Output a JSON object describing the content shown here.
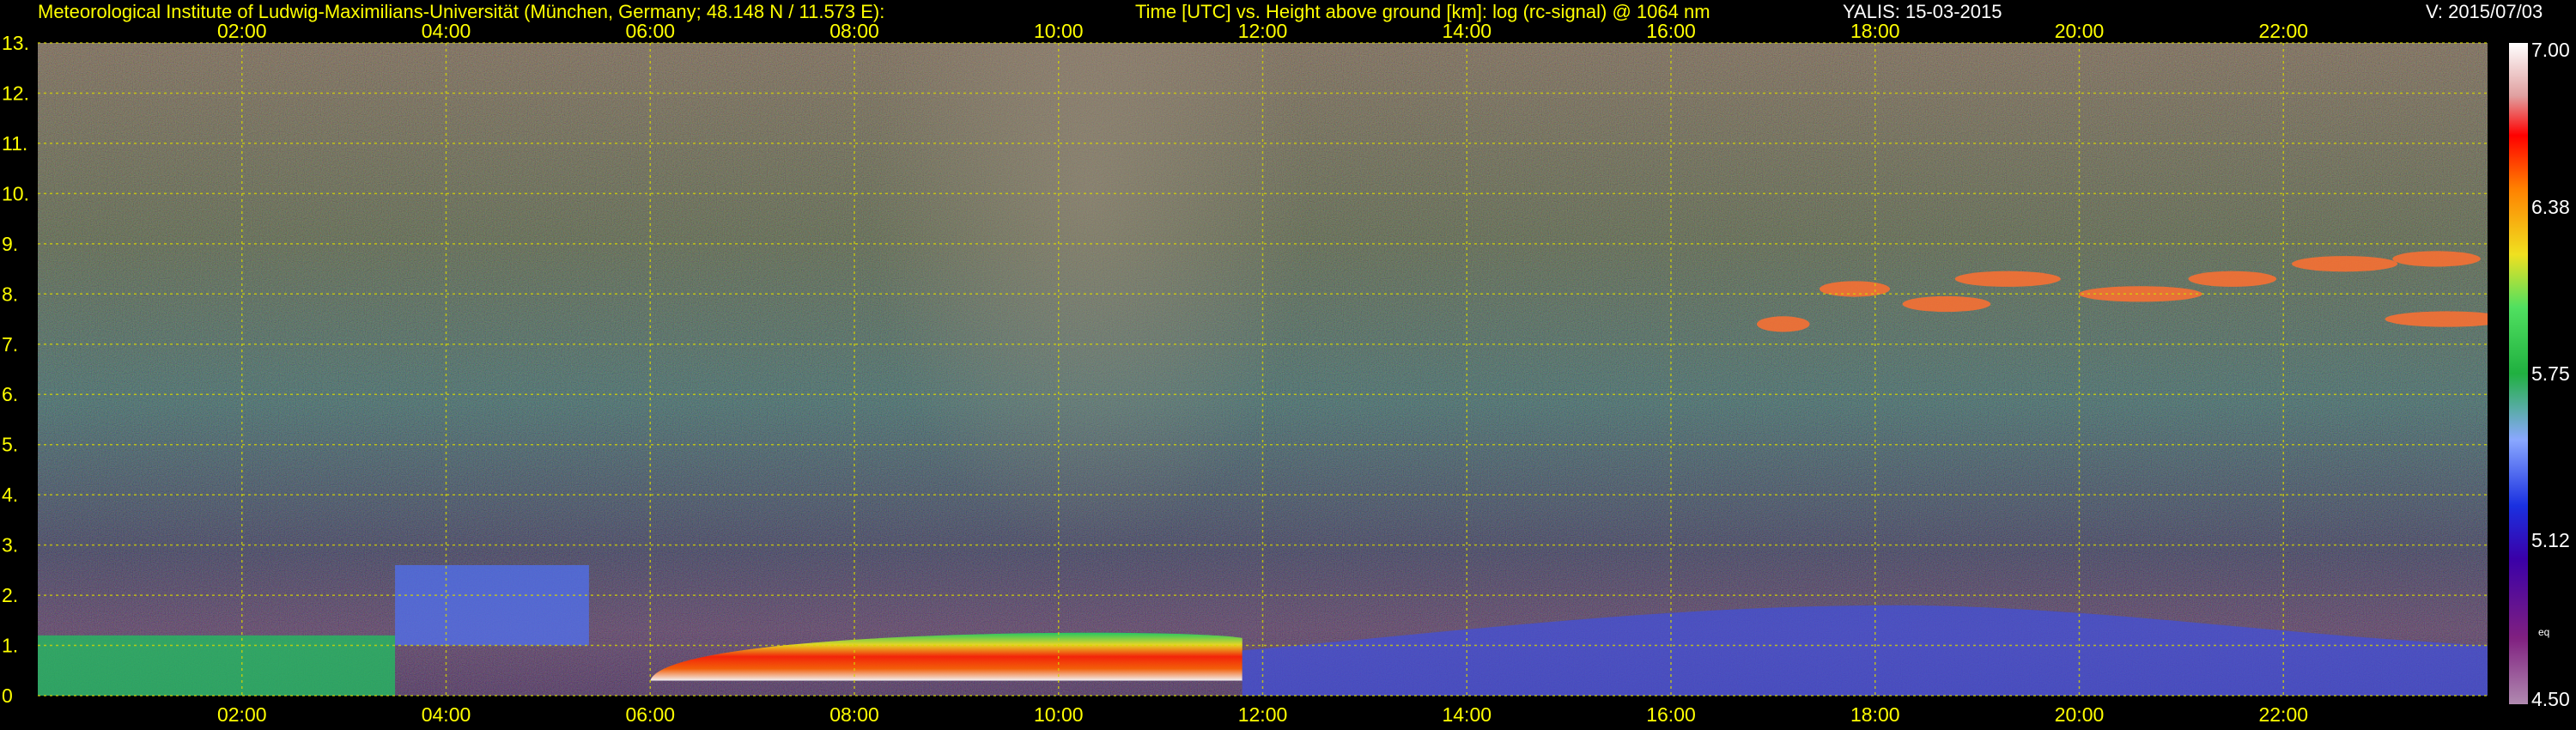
{
  "header": {
    "institute": "Meteorological Institute of Ludwig-Maximilians-Universität (München, Germany; 48.148 N / 11.573 E):",
    "description": "Time [UTC] vs. Height above ground [km]: log (rc-signal) @ 1064 nm",
    "system": "YALIS: 15-03-2015",
    "version": "V: 2015/07/03"
  },
  "chart_data": {
    "type": "heatmap",
    "title": "Time [UTC] vs. Height above ground [km]: log (rc-signal) @ 1064 nm",
    "x_ticks": [
      "02:00",
      "04:00",
      "06:00",
      "08:00",
      "10:00",
      "12:00",
      "14:00",
      "16:00",
      "18:00",
      "20:00",
      "22:00"
    ],
    "x_tick_hours": [
      2,
      4,
      6,
      8,
      10,
      12,
      14,
      16,
      18,
      20,
      22
    ],
    "xlim_hours": [
      0,
      24
    ],
    "y_ticks": [
      "0",
      "1.",
      "2.",
      "3.",
      "4.",
      "5.",
      "6.",
      "7.",
      "8.",
      "9.",
      "10.",
      "11.",
      "12.",
      "13."
    ],
    "y_tick_values": [
      0,
      1,
      2,
      3,
      4,
      5,
      6,
      7,
      8,
      9,
      10,
      11,
      12,
      13
    ],
    "ylim_km": [
      0,
      13
    ],
    "grid": true,
    "colorbar": {
      "ticks": [
        "7.00",
        "6.38",
        "5.75",
        "5.12",
        "4.50"
      ],
      "tick_values": [
        7.0,
        6.38,
        5.75,
        5.12,
        4.5
      ],
      "range": [
        4.5,
        7.0
      ],
      "small_label": "eq"
    },
    "features": [
      {
        "name": "boundary layer aerosol",
        "t_start": 6.0,
        "t_end": 11.8,
        "h_bottom": 0.3,
        "h_top": 1.35,
        "level": 6.5
      },
      {
        "name": "residual layer",
        "t_start": 0.0,
        "t_end": 3.5,
        "h_bottom": 0.0,
        "h_top": 1.2,
        "level": 5.9
      },
      {
        "name": "low cloud block",
        "t_start": 3.5,
        "t_end": 5.4,
        "h_bottom": 1.0,
        "h_top": 2.6,
        "level": 5.2
      },
      {
        "name": "afternoon mixing layer",
        "t_start": 11.8,
        "t_end": 24.0,
        "h_bottom": 0.0,
        "h_top": 1.8,
        "level": 5.3
      },
      {
        "name": "cirrus clouds",
        "t_start": 17.0,
        "t_end": 24.0,
        "h_bottom": 7.0,
        "h_top": 9.0,
        "level": 6.4
      }
    ]
  },
  "colors": {
    "axis_text": "#ffff00",
    "grid": "#d6d600",
    "colorbar_text": "#ffffff"
  }
}
